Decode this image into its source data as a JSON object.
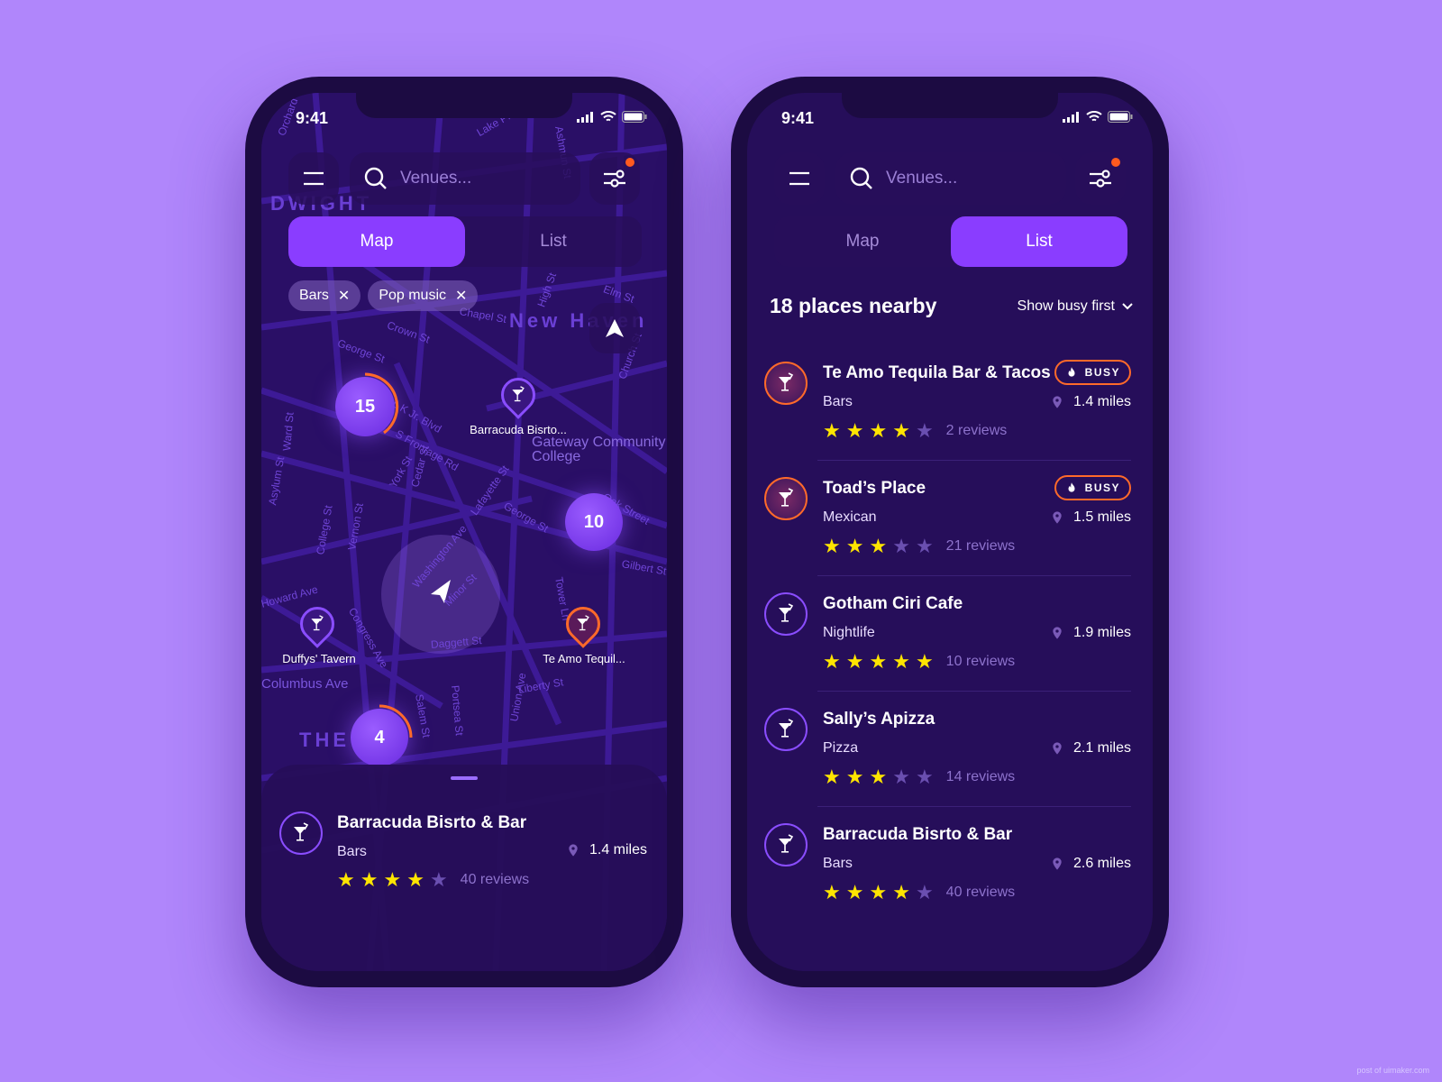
{
  "colors": {
    "background": "#b086fb",
    "accent": "#8a3dff",
    "busy": "#ff6a2a",
    "star": "#ffe500",
    "star_empty": "#6a4fb0"
  },
  "status": {
    "time": "9:41"
  },
  "search": {
    "placeholder": "Venues..."
  },
  "tabs": {
    "map": "Map",
    "list": "List"
  },
  "filters": [
    {
      "label": "Bars"
    },
    {
      "label": "Pop music"
    }
  ],
  "map": {
    "area_labels": [
      "DWIGHT",
      "New Haven",
      "THE"
    ],
    "streets": [
      "Orchard St",
      "Lake Pl",
      "Ashmun St",
      "Elm St",
      "Chapel St",
      "Crown St",
      "George St",
      "High St",
      "Church St",
      "M L K Jr. Blvd",
      "S Frontage Rd",
      "York St",
      "Cedar St",
      "Ward St",
      "Asylum St",
      "Vernon St",
      "College St",
      "Lafayette St",
      "George St",
      "Oak Street",
      "Gilbert St",
      "Washington Ave",
      "Minor St",
      "Daggett St",
      "Congress Ave",
      "Howard Ave",
      "Salem St",
      "Portsea St",
      "Liberty St",
      "Union Ave",
      "Columbus Ave",
      "Tower Ln",
      "Gateway Community College"
    ],
    "clusters": [
      {
        "count": "15",
        "busy": true
      },
      {
        "count": "10",
        "busy": false
      },
      {
        "count": "4",
        "busy": true
      }
    ],
    "pins": [
      {
        "label": "Barracuda Bisrto...",
        "busy": false
      },
      {
        "label": "Duffys' Tavern",
        "busy": false
      },
      {
        "label": "Te Amo Tequil...",
        "busy": true
      }
    ]
  },
  "sheet": {
    "name": "Barracuda Bisrto & Bar",
    "category": "Bars",
    "distance": "1.4 miles",
    "rating": 4,
    "reviews": "40 reviews"
  },
  "list": {
    "count_title": "18 places nearby",
    "sort": "Show busy first",
    "busy_label": "BUSY",
    "items": [
      {
        "name": "Te Amo Tequila Bar & Tacos",
        "category": "Bars",
        "distance": "1.4 miles",
        "rating": 4,
        "reviews": "2 reviews",
        "busy": true
      },
      {
        "name": "Toad’s Place",
        "category": "Mexican",
        "distance": "1.5 miles",
        "rating": 3,
        "reviews": "21 reviews",
        "busy": true
      },
      {
        "name": "Gotham Ciri Cafe",
        "category": "Nightlife",
        "distance": "1.9 miles",
        "rating": 5,
        "reviews": "10 reviews",
        "busy": false
      },
      {
        "name": "Sally’s Apizza",
        "category": "Pizza",
        "distance": "2.1 miles",
        "rating": 3,
        "reviews": "14 reviews",
        "busy": false
      },
      {
        "name": "Barracuda Bisrto & Bar",
        "category": "Bars",
        "distance": "2.6 miles",
        "rating": 4,
        "reviews": "40 reviews",
        "busy": false
      }
    ]
  },
  "watermark": "post of uimaker.com"
}
